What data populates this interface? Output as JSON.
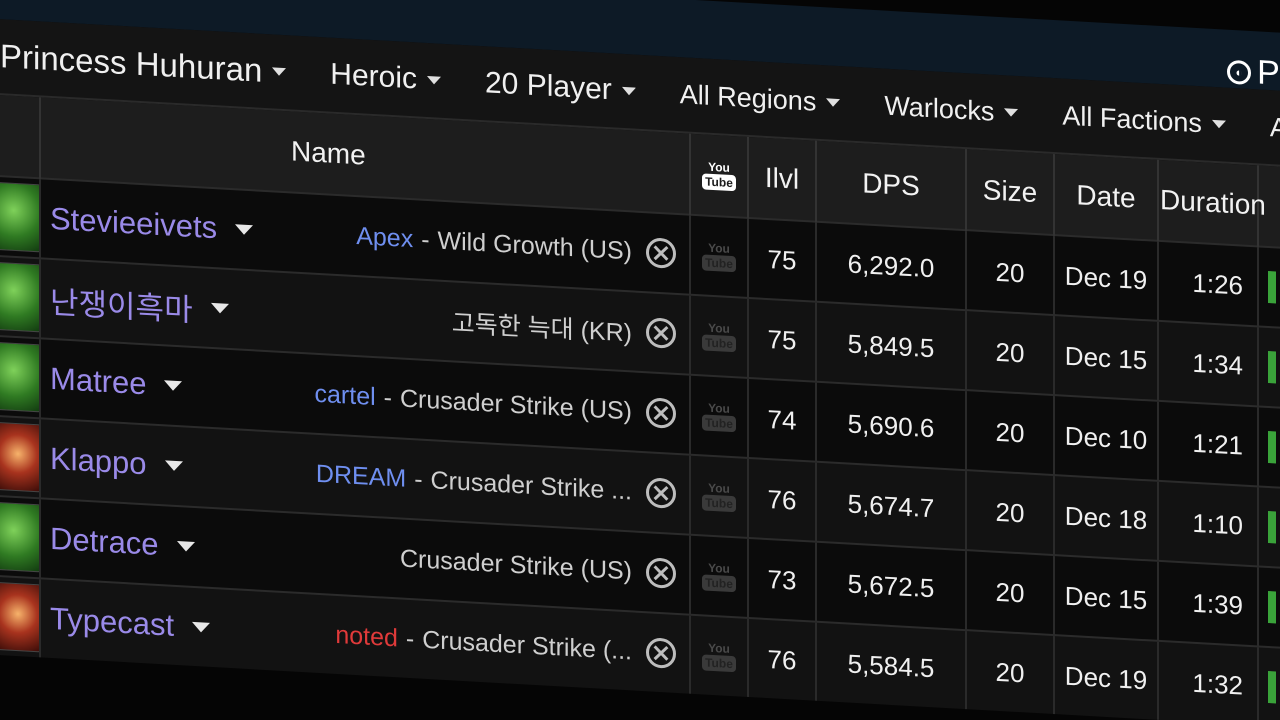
{
  "brand": {
    "label": "Pro"
  },
  "filters": [
    {
      "label": "Princess Huhuran"
    },
    {
      "label": "Heroic"
    },
    {
      "label": "20 Player"
    },
    {
      "label": "All Regions"
    },
    {
      "label": "Warlocks"
    },
    {
      "label": "All Factions"
    },
    {
      "label": "All Ite"
    }
  ],
  "table": {
    "headers": {
      "name": "Name",
      "youtube_you": "You",
      "youtube_tube": "Tube",
      "ilvl": "Ilvl",
      "dps": "DPS",
      "size": "Size",
      "date": "Date",
      "duration": "Duration"
    },
    "rows": [
      {
        "player": "Stevieeivets",
        "guild": "Apex",
        "guild_color": "blue",
        "server": "Wild Growth (US)",
        "ilvl": "75",
        "dps": "6,292.0",
        "size": "20",
        "date": "Dec 19",
        "duration": "1:26",
        "avatar": "green"
      },
      {
        "player": "난쟁이흑마",
        "guild": "",
        "guild_color": "blue",
        "server": "고독한 늑대 (KR)",
        "ilvl": "75",
        "dps": "5,849.5",
        "size": "20",
        "date": "Dec 15",
        "duration": "1:34",
        "avatar": "green"
      },
      {
        "player": "Matree",
        "guild": "cartel",
        "guild_color": "blue",
        "server": "Crusader Strike (US)",
        "ilvl": "74",
        "dps": "5,690.6",
        "size": "20",
        "date": "Dec 10",
        "duration": "1:21",
        "avatar": "green"
      },
      {
        "player": "Klappo",
        "guild": "DREAM",
        "guild_color": "blue",
        "server": "Crusader Strike ...",
        "ilvl": "76",
        "dps": "5,674.7",
        "size": "20",
        "date": "Dec 18",
        "duration": "1:10",
        "avatar": "red"
      },
      {
        "player": "Detrace",
        "guild": "",
        "guild_color": "blue",
        "server": "Crusader Strike (US)",
        "ilvl": "73",
        "dps": "5,672.5",
        "size": "20",
        "date": "Dec 15",
        "duration": "1:39",
        "avatar": "green"
      },
      {
        "player": "Typecast",
        "guild": "noted",
        "guild_color": "red",
        "server": "Crusader Strike (...",
        "ilvl": "76",
        "dps": "5,584.5",
        "size": "20",
        "date": "Dec 19",
        "duration": "1:32",
        "avatar": "red"
      }
    ]
  },
  "colors": {
    "player_name": "#9a8ae8",
    "guild_blue": "#6f8ff0",
    "guild_red": "#e03a3a",
    "dps": "#a6d36a"
  },
  "icons": {
    "brand": "globe-icon",
    "filter_caret": "caret-down-icon",
    "player_caret": "caret-down-icon",
    "server_link": "x-circle-icon",
    "video": "youtube-icon"
  }
}
